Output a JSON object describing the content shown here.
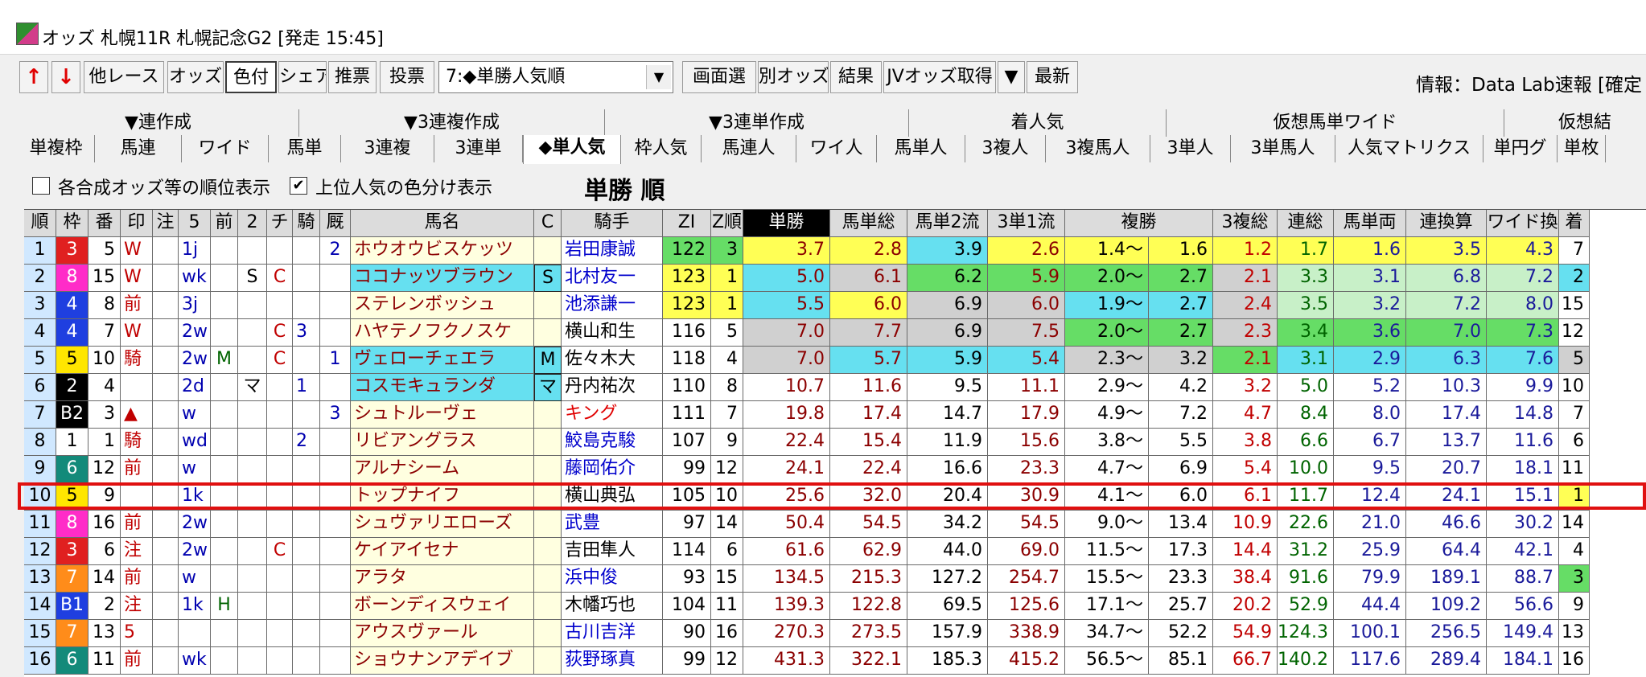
{
  "window": {
    "title": "オッズ 札幌11R 札幌記念G2 [発走 15:45]"
  },
  "toolbar": {
    "up_label": "↑",
    "down_label": "↓",
    "buttons": [
      "他レース",
      "オッズ",
      "色付",
      "シェア",
      "推票",
      "投票"
    ],
    "select_value": "7:◆単勝人気順",
    "buttons2": [
      "画面選",
      "別オッズ",
      "結果",
      "JVオッズ取得",
      "▼",
      "最新"
    ],
    "info": "情報：Data Lab速報 [確定"
  },
  "tabs_top": [
    "▼連作成",
    "▼3連複作成",
    "▼3連単作成",
    "着人気",
    "仮想馬単ワイド",
    "仮想結"
  ],
  "tabs_bottom": [
    "単複枠",
    "馬連",
    "ワイド",
    "馬単",
    "3連複",
    "3連単",
    "◆単人気",
    "枠人気",
    "馬連人",
    "ワイ人",
    "馬単人",
    "3複人",
    "3複馬人",
    "3単人",
    "3単馬人",
    "人気マトリクス",
    "単円グ",
    "単枚"
  ],
  "options": {
    "opt1": "各合成オッズ等の順位表示",
    "opt2": "上位人気の色分け表示",
    "opt2_checked": "✔",
    "title": "単勝 順"
  },
  "columns": [
    "順",
    "枠",
    "番",
    "印",
    "注",
    "5",
    "前",
    "2",
    "チ",
    "騎",
    "厩",
    "馬名",
    "C",
    "騎手",
    "ZI",
    "Z順",
    "単勝",
    "馬単総",
    "馬単2流",
    "3単1流",
    "複勝",
    "3複総",
    "連総",
    "馬単両",
    "連換算",
    "ワイド換",
    "着"
  ],
  "rows": [
    [
      "1",
      "3",
      "5",
      "W",
      "",
      "1j",
      "",
      "",
      "",
      "",
      "2",
      "ホウオウビスケッツ",
      "",
      "岩田康誠",
      "122",
      "3",
      "3.7",
      "2.8",
      "3.9",
      "2.6",
      "1.4～",
      "1.6",
      "1.2",
      "1.7",
      "1.6",
      "3.5",
      "4.3",
      "7"
    ],
    [
      "2",
      "8",
      "15",
      "W",
      "",
      "wk",
      "",
      "S",
      "C",
      "",
      "",
      "ココナッツブラウン",
      "S",
      "北村友一",
      "123",
      "1",
      "5.0",
      "6.1",
      "6.2",
      "5.9",
      "2.0～",
      "2.7",
      "2.1",
      "3.3",
      "3.1",
      "6.8",
      "7.2",
      "2"
    ],
    [
      "3",
      "4",
      "8",
      "前",
      "",
      "3j",
      "",
      "",
      "",
      "",
      "",
      "ステレンボッシュ",
      "",
      "池添謙一",
      "123",
      "1",
      "5.5",
      "6.0",
      "6.9",
      "6.0",
      "1.9～",
      "2.7",
      "2.4",
      "3.5",
      "3.2",
      "7.2",
      "8.0",
      "15"
    ],
    [
      "4",
      "4",
      "7",
      "W",
      "",
      "2w",
      "",
      "",
      "C",
      "3",
      "",
      "ハヤテノフクノスケ",
      "",
      "横山和生",
      "116",
      "5",
      "7.0",
      "7.7",
      "6.9",
      "7.5",
      "2.0～",
      "2.7",
      "2.3",
      "3.4",
      "3.6",
      "7.0",
      "7.3",
      "12"
    ],
    [
      "5",
      "5",
      "10",
      "騎",
      "",
      "2w",
      "M",
      "",
      "C",
      "",
      "1",
      "ヴェローチェエラ",
      "M",
      "佐々木大",
      "118",
      "4",
      "7.0",
      "5.7",
      "5.9",
      "5.4",
      "2.3～",
      "3.2",
      "2.1",
      "3.1",
      "2.9",
      "6.3",
      "7.6",
      "5"
    ],
    [
      "6",
      "2",
      "4",
      "",
      "",
      "2d",
      "",
      "マ",
      "",
      "1",
      "",
      "コスモキュランダ",
      "マ",
      "丹内祐次",
      "110",
      "8",
      "10.7",
      "11.6",
      "9.5",
      "11.1",
      "2.9～",
      "4.2",
      "3.2",
      "5.0",
      "5.2",
      "10.3",
      "9.9",
      "10"
    ],
    [
      "7",
      "B2",
      "3",
      "▲",
      "",
      "w",
      "",
      "",
      "",
      "",
      "3",
      "シュトルーヴェ",
      "",
      "キング",
      "111",
      "7",
      "19.8",
      "17.4",
      "14.7",
      "17.9",
      "4.9～",
      "7.2",
      "4.7",
      "8.4",
      "8.0",
      "17.4",
      "14.8",
      "7"
    ],
    [
      "8",
      "1",
      "1",
      "騎",
      "",
      "wd",
      "",
      "",
      "",
      "2",
      "",
      "リビアングラス",
      "",
      "鮫島克駿",
      "107",
      "9",
      "22.4",
      "15.4",
      "11.9",
      "15.6",
      "3.8～",
      "5.5",
      "3.8",
      "6.6",
      "6.7",
      "13.7",
      "11.6",
      "6"
    ],
    [
      "9",
      "6",
      "12",
      "前",
      "",
      "w",
      "",
      "",
      "",
      "",
      "",
      "アルナシーム",
      "",
      "藤岡佑介",
      "99",
      "12",
      "24.1",
      "22.4",
      "16.6",
      "23.3",
      "4.7～",
      "6.9",
      "5.4",
      "10.0",
      "9.5",
      "20.7",
      "18.1",
      "11"
    ],
    [
      "10",
      "5",
      "9",
      "",
      "",
      "1k",
      "",
      "",
      "",
      "",
      "",
      "トップナイフ",
      "",
      "横山典弘",
      "105",
      "10",
      "25.6",
      "32.0",
      "20.4",
      "30.9",
      "4.1～",
      "6.0",
      "6.1",
      "11.7",
      "12.4",
      "24.1",
      "15.1",
      "1"
    ],
    [
      "11",
      "8",
      "16",
      "前",
      "",
      "2w",
      "",
      "",
      "",
      "",
      "",
      "シュヴァリエローズ",
      "",
      "武豊",
      "97",
      "14",
      "50.4",
      "54.5",
      "34.2",
      "54.5",
      "9.0～",
      "13.4",
      "10.9",
      "22.6",
      "21.0",
      "46.6",
      "30.2",
      "14"
    ],
    [
      "12",
      "3",
      "6",
      "注",
      "",
      "2w",
      "",
      "",
      "C",
      "",
      "",
      "ケイアイセナ",
      "",
      "吉田隼人",
      "114",
      "6",
      "61.6",
      "62.9",
      "44.0",
      "69.0",
      "11.5～",
      "17.3",
      "14.4",
      "31.2",
      "25.9",
      "64.4",
      "42.1",
      "4"
    ],
    [
      "13",
      "7",
      "14",
      "前",
      "",
      "w",
      "",
      "",
      "",
      "",
      "",
      "アラタ",
      "",
      "浜中俊",
      "93",
      "15",
      "134.5",
      "215.3",
      "127.2",
      "254.7",
      "15.5～",
      "23.3",
      "38.4",
      "91.6",
      "79.9",
      "189.1",
      "88.7",
      "3"
    ],
    [
      "14",
      "B1",
      "2",
      "注",
      "",
      "1k",
      "H",
      "",
      "",
      "",
      "",
      "ボーンディスウェイ",
      "",
      "木幡巧也",
      "104",
      "11",
      "139.3",
      "122.8",
      "69.5",
      "125.6",
      "17.1～",
      "25.7",
      "20.2",
      "52.9",
      "44.4",
      "109.2",
      "56.6",
      "9"
    ],
    [
      "15",
      "7",
      "13",
      "5",
      "",
      "",
      "",
      "",
      "",
      "",
      "",
      "アウスヴァール",
      "",
      "古川吉洋",
      "90",
      "16",
      "270.3",
      "273.5",
      "157.9",
      "338.9",
      "34.7～",
      "52.2",
      "54.9",
      "124.3",
      "100.1",
      "256.5",
      "149.4",
      "13"
    ],
    [
      "16",
      "6",
      "11",
      "前",
      "",
      "wk",
      "",
      "",
      "",
      "",
      "",
      "ショウナンアデイブ",
      "",
      "荻野琢真",
      "99",
      "12",
      "431.3",
      "322.1",
      "185.3",
      "415.2",
      "56.5～",
      "85.1",
      "66.7",
      "140.2",
      "117.6",
      "289.4",
      "184.1",
      "16"
    ]
  ],
  "colors": {
    "waku": {
      "1": "#ffffff",
      "2": "#000000",
      "3": "#e02020",
      "4": "#1f3fe0",
      "5": "#ffe600",
      "6": "#138a7a",
      "7": "#ff8c1a",
      "8": "#ff2cc8",
      "B1": "#1f3fe0",
      "B2": "#000000"
    }
  }
}
